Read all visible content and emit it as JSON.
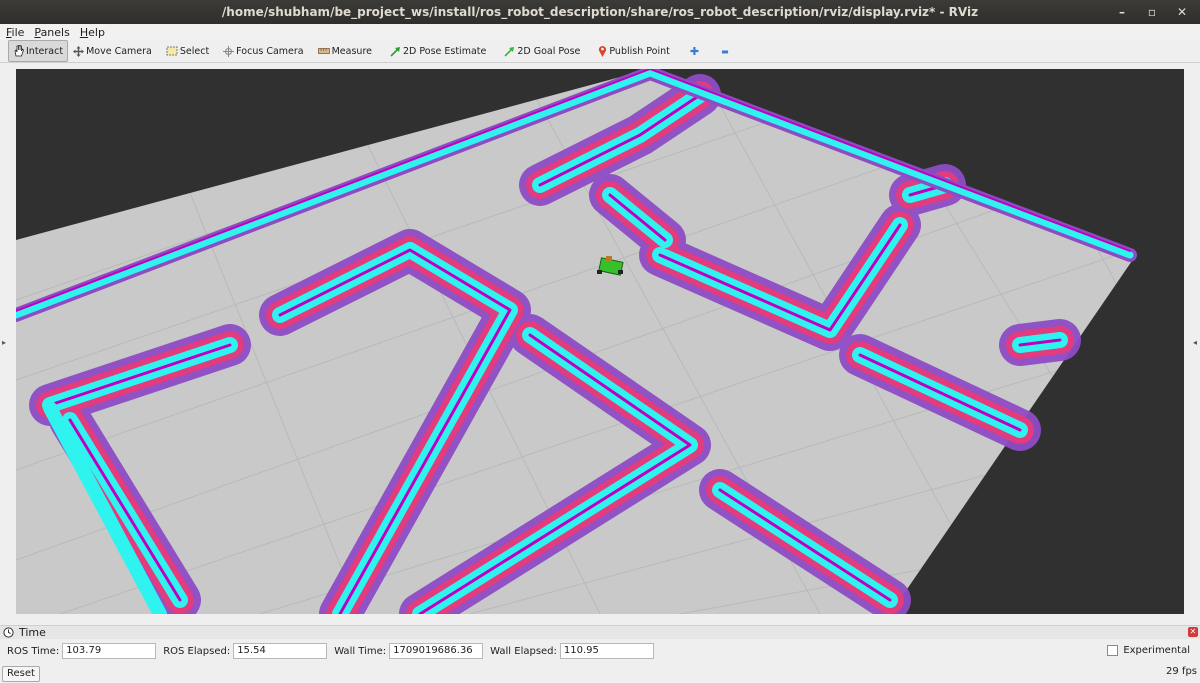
{
  "window": {
    "title": "/home/shubham/be_project_ws/install/ros_robot_description/share/ros_robot_description/rviz/display.rviz* - RViz",
    "controls": {
      "minimize": "–",
      "maximize": "▫",
      "close": "✕"
    }
  },
  "menu": {
    "file": "File",
    "panels": "Panels",
    "help": "Help"
  },
  "toolbar": {
    "interact": "Interact",
    "move_camera": "Move Camera",
    "select": "Select",
    "focus_camera": "Focus Camera",
    "measure": "Measure",
    "pose_estimate": "2D Pose Estimate",
    "goal_pose": "2D Goal Pose",
    "publish_point": "Publish Point",
    "add_tool": "✚",
    "remove_tool": "▬"
  },
  "viewport": {
    "background": "#303030",
    "floor_color": "#c9c9c9",
    "grid_color": "#b8b8b8",
    "wall_color": "#2ff3ee",
    "inflation_inner": "#e23b7e",
    "inflation_outer": "#8d4cc4",
    "obstacle_color": "#c000c0",
    "robot_color": "#35c02c"
  },
  "time_panel": {
    "title": "Time",
    "ros_time_label": "ROS Time:",
    "ros_time": "103.79",
    "ros_elapsed_label": "ROS Elapsed:",
    "ros_elapsed": "15.54",
    "wall_time_label": "Wall Time:",
    "wall_time": "1709019686.36",
    "wall_elapsed_label": "Wall Elapsed:",
    "wall_elapsed": "110.95",
    "experimental_label": "Experimental",
    "experimental_checked": false
  },
  "footer": {
    "reset": "Reset",
    "fps": "29 fps"
  }
}
